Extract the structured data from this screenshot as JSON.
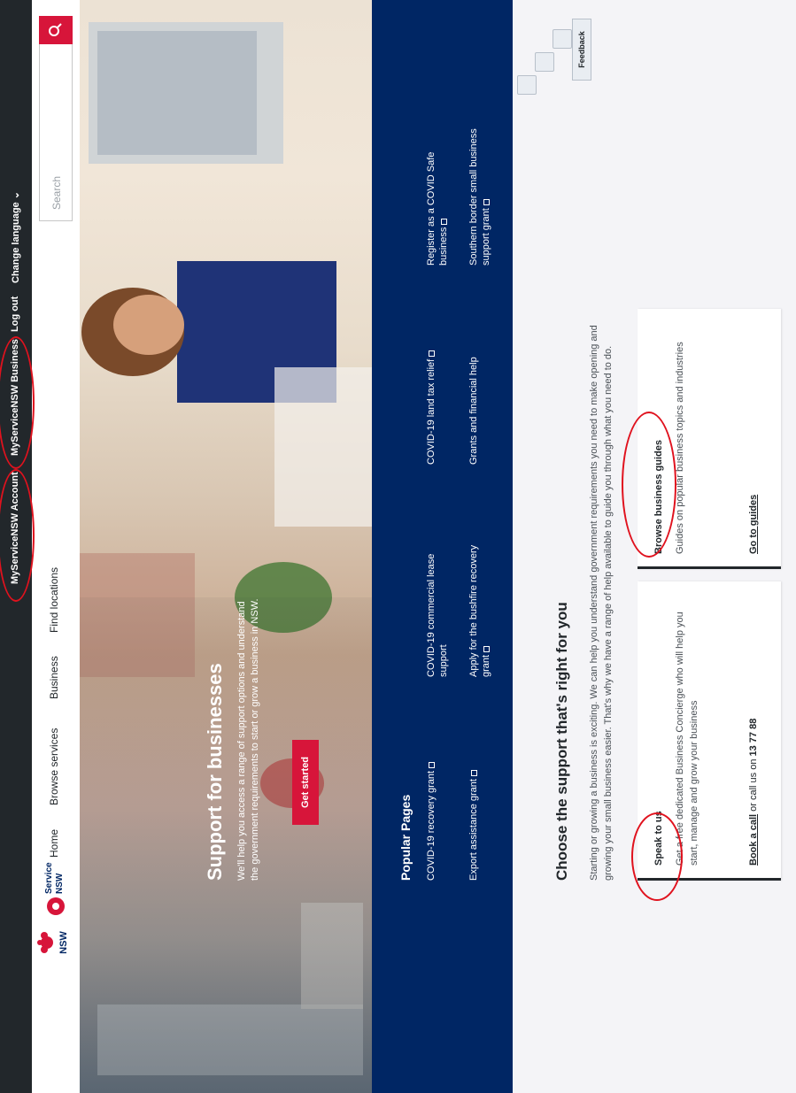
{
  "utility_bar": {
    "account": "MyServiceNSW Account",
    "business_account": "MyServiceNSW Business",
    "log_out": "Log out",
    "change_language": "Change language ⌄"
  },
  "header": {
    "nsw_logo_text": "NSW",
    "service_nsw_logo_text": "Service NSW",
    "nav": [
      "Home",
      "Browse services",
      "Business",
      "Find locations"
    ],
    "search_placeholder": "Search"
  },
  "hero": {
    "title": "Support for businesses",
    "description": "We'll help you access a range of support options and understand the government requirements to start or grow a business in NSW.",
    "button": "Get started"
  },
  "popular": {
    "title": "Popular Pages",
    "links": [
      "COVID-19 recovery grant",
      "COVID-19 commercial lease support",
      "COVID-19 land tax relief",
      "Register as a COVID Safe business",
      "Export assistance grant",
      "Apply for the bushfire recovery grant",
      "Grants and financial help",
      "Southern border small business support grant"
    ]
  },
  "main": {
    "title": "Choose the support that's right for you",
    "description": "Starting or growing a business is exciting. We can help you understand government requirements you need to make opening and growing your small business easier. That's why we have a range of help available to guide you through what you need to do.",
    "cards": [
      {
        "title": "Speak to us",
        "description": "Get a free dedicated Business Concierge who will help you start, manage and grow your business",
        "link_text": "Book a call",
        "link_middle": " or call us on ",
        "link_phone": "13 77 88"
      },
      {
        "title": "Browse business guides",
        "description": "Guides on popular business topics and industries",
        "link_text": "Go to guides"
      }
    ]
  },
  "feedback": {
    "label": "Feedback"
  },
  "colors": {
    "brand_red": "#d7153a",
    "brand_navy": "#002664",
    "utility_bar": "#22272b",
    "annotation_red": "#e0121e"
  }
}
